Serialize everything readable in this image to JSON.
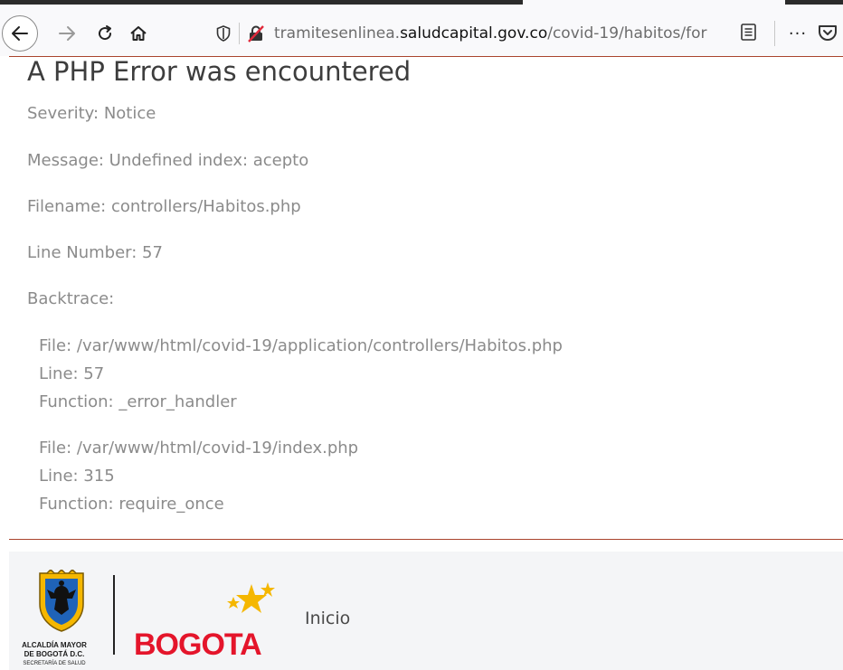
{
  "browser": {
    "url_prefix": "tramitesenlinea.",
    "url_host": "saludcapital.gov.co",
    "url_path": "/covid-19/habitos/for",
    "more_label": "···"
  },
  "error": {
    "title": "A PHP Error was encountered",
    "severity": "Severity: Notice",
    "message": "Message: Undefined index: acepto",
    "filename": "Filename: controllers/Habitos.php",
    "line_number": "Line Number: 57",
    "backtrace_label": "Backtrace:",
    "backtrace": [
      {
        "file": "File: /var/www/html/covid-19/application/controllers/Habitos.php",
        "line": "Line: 57",
        "function": "Function: _error_handler"
      },
      {
        "file": "File: /var/www/html/covid-19/index.php",
        "line": "Line: 315",
        "function": "Function: require_once"
      }
    ]
  },
  "footer": {
    "crest_line1": "ALCALDÍA MAYOR",
    "crest_line2": "DE BOGOTÁ D.C.",
    "crest_line3": "SECRETARÍA DE SALUD",
    "brand": "BOGOTA",
    "link_inicio": "Inicio"
  },
  "colors": {
    "rule": "#a9442d",
    "brand_red": "#e4152b",
    "brand_yellow": "#f5b700"
  }
}
